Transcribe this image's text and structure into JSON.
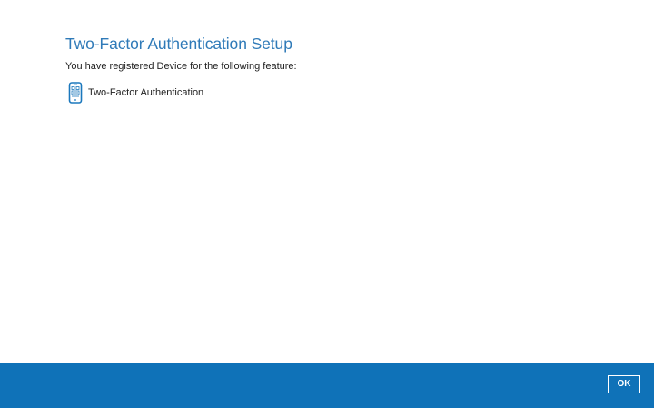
{
  "header": {
    "title": "Two-Factor Authentication Setup",
    "subtitle": "You have registered Device for the following feature:"
  },
  "features": [
    {
      "icon": "mobile-device-icon",
      "label": "Two-Factor Authentication"
    }
  ],
  "footer": {
    "ok_label": "OK"
  },
  "colors": {
    "title": "#2f7ab8",
    "footer_bg": "#0f72b8",
    "icon": "#1b78bd"
  }
}
